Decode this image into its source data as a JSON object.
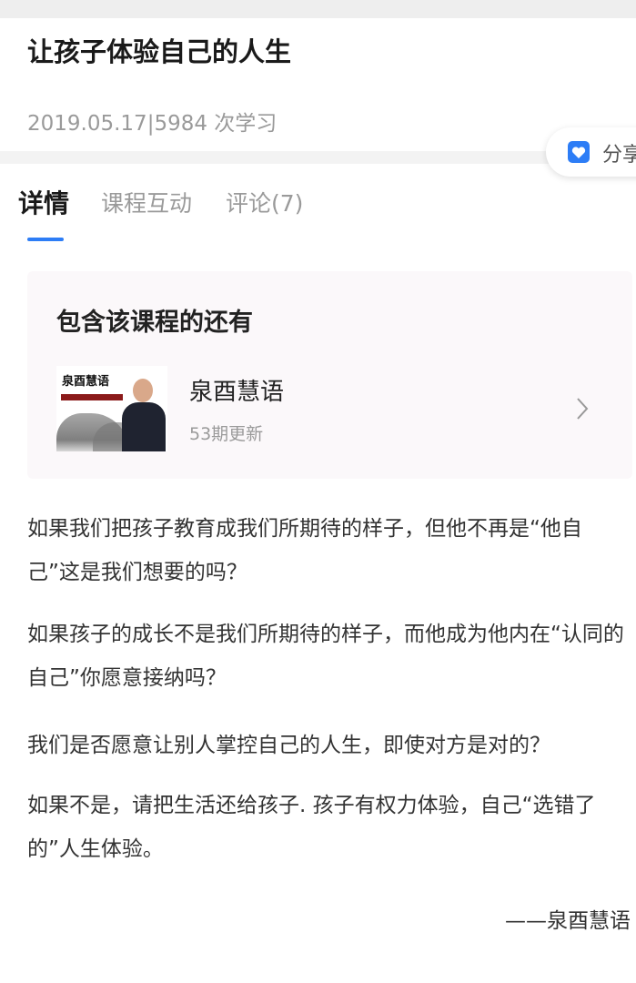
{
  "article": {
    "title": "让孩子体验自己的人生",
    "meta": "2019.05.17|5984 次学习",
    "share_label": "分享",
    "tabs": [
      {
        "label": "详情",
        "active": true
      },
      {
        "label": "课程互动",
        "active": false
      },
      {
        "label": "评论(7)",
        "active": false
      }
    ]
  },
  "related": {
    "heading": "包含该课程的还有",
    "course": {
      "name": "泉酉慧语",
      "update_count": "53期更新",
      "thumbnail_brand": "泉酉慧语"
    }
  },
  "content": {
    "paragraphs": [
      "如果我们把孩子教育成我们所期待的样子，但他不再是“他自己”这是我们想要的吗？",
      "如果孩子的成长不是我们所期待的样子，而他成为他内在“认同的自己”你愿意接纳吗？",
      "我们是否愿意让别人掌控自己的人生，即使对方是对的？",
      "如果不是，请把生活还给孩子. 孩子有权力体验，自己“选错了的”人生体验。"
    ],
    "signature": "——泉酉慧语"
  },
  "colors": {
    "accent": "#2d7df6",
    "muted_text": "#9a9a9a",
    "card_bg": "#fbf8fa"
  }
}
